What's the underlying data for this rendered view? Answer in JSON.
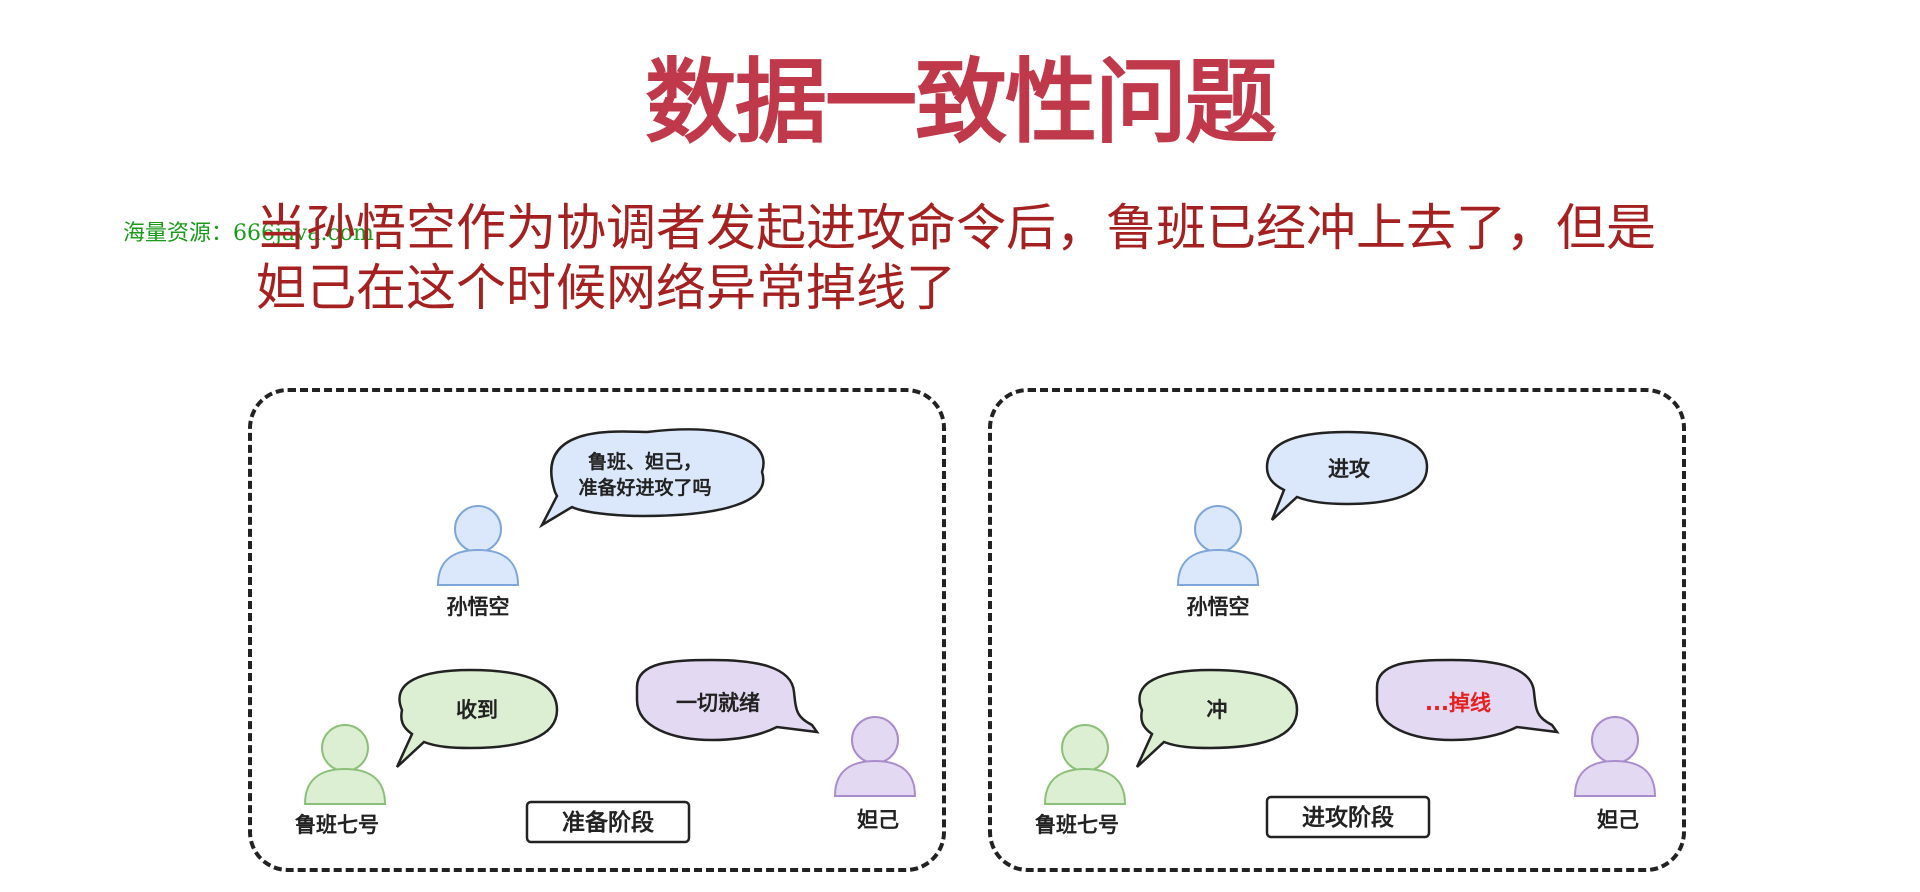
{
  "title": "数据一致性问题",
  "watermark": "海量资源：666java.com",
  "description": "当孙悟空作为协调者发起进攻命令后，鲁班已经冲上去了，但是妲己在这个时候网络异常掉线了",
  "colors": {
    "title": "#c0394b",
    "description": "#a52020",
    "watermark": "#1a9a1a",
    "alert": "#e62020"
  },
  "panels": [
    {
      "stage": "准备阶段",
      "sunwukong": {
        "name": "孙悟空",
        "bubble_line1": "鲁班、妲己，",
        "bubble_line2": "准备好进攻了吗"
      },
      "luban": {
        "name": "鲁班七号",
        "bubble": "收到"
      },
      "daji": {
        "name": "妲己",
        "bubble": "一切就绪"
      }
    },
    {
      "stage": "进攻阶段",
      "sunwukong": {
        "name": "孙悟空",
        "bubble": "进攻"
      },
      "luban": {
        "name": "鲁班七号",
        "bubble": "冲"
      },
      "daji": {
        "name": "妲己",
        "bubble": "...掉线"
      }
    }
  ]
}
